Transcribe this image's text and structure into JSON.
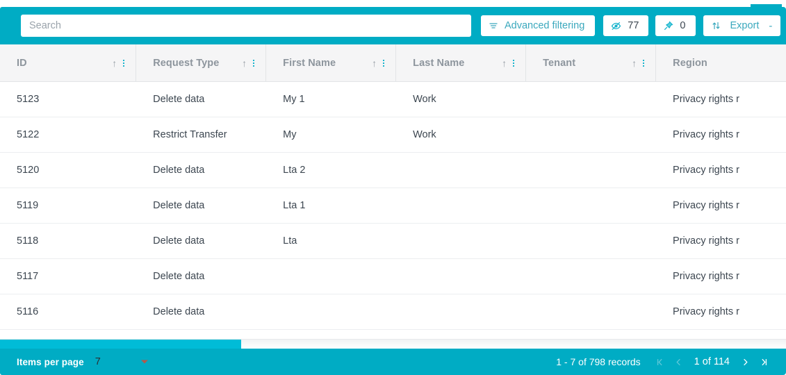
{
  "theme": {
    "accent": "#00acc4",
    "accent_light": "#00bcd7",
    "link": "#3aa8bd",
    "header_bg": "#f5f5f6",
    "header_text": "#8d959d",
    "body_text": "#3c4650"
  },
  "toolbar": {
    "search": {
      "placeholder": "Search",
      "value": ""
    },
    "advanced_filtering": {
      "label": "Advanced filtering",
      "icon": "filter-icon"
    },
    "hidden_columns": {
      "count": "77",
      "icon": "eye-slash-icon"
    },
    "pinned_columns": {
      "count": "0",
      "icon": "pin-icon"
    },
    "export": {
      "label": "Export",
      "icon": "export-sort-icon",
      "caret": "-"
    }
  },
  "table": {
    "columns": [
      {
        "key": "id",
        "label": "ID",
        "sortable": true,
        "menu": true
      },
      {
        "key": "request_type",
        "label": "Request Type",
        "sortable": true,
        "menu": true
      },
      {
        "key": "first_name",
        "label": "First Name",
        "sortable": true,
        "menu": true
      },
      {
        "key": "last_name",
        "label": "Last Name",
        "sortable": true,
        "menu": true
      },
      {
        "key": "tenant",
        "label": "Tenant",
        "sortable": true,
        "menu": true
      },
      {
        "key": "region",
        "label": "Region",
        "sortable": false,
        "menu": false
      }
    ],
    "sort_icon": "↑",
    "rows": [
      {
        "id": "5123",
        "request_type": "Delete data",
        "first_name": "My 1",
        "last_name": "Work",
        "tenant": "",
        "region": "Privacy rights r"
      },
      {
        "id": "5122",
        "request_type": "Restrict Transfer",
        "first_name": "My",
        "last_name": "Work",
        "tenant": "",
        "region": "Privacy rights r"
      },
      {
        "id": "5120",
        "request_type": "Delete data",
        "first_name": "Lta 2",
        "last_name": "",
        "tenant": "",
        "region": "Privacy rights r"
      },
      {
        "id": "5119",
        "request_type": "Delete data",
        "first_name": "Lta 1",
        "last_name": "",
        "tenant": "",
        "region": "Privacy rights r"
      },
      {
        "id": "5118",
        "request_type": "Delete data",
        "first_name": "Lta",
        "last_name": "",
        "tenant": "",
        "region": "Privacy rights r"
      },
      {
        "id": "5117",
        "request_type": "Delete data",
        "first_name": "",
        "last_name": "",
        "tenant": "",
        "region": "Privacy rights r"
      },
      {
        "id": "5116",
        "request_type": "Delete data",
        "first_name": "",
        "last_name": "",
        "tenant": "",
        "region": "Privacy rights r"
      }
    ]
  },
  "footer": {
    "items_per_page_label": "Items per page",
    "items_per_page_value": "7",
    "record_range": "1 - 7 of 798 records",
    "page_indicator": "1 of 114",
    "first_page": "⏮",
    "prev_page": "‹",
    "next_page": "›",
    "last_page": "⏭"
  }
}
